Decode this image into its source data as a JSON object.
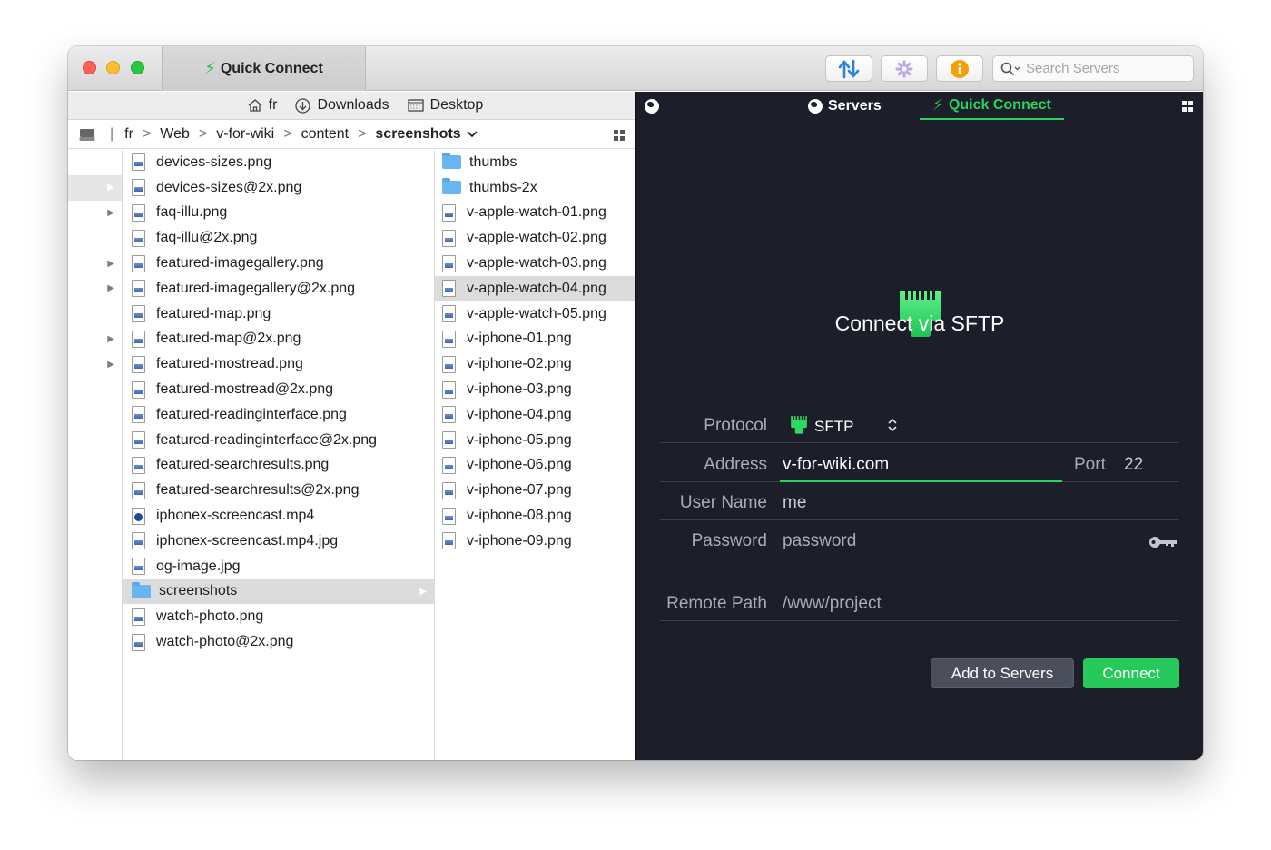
{
  "titlebar": {
    "tab_label": "Quick Connect",
    "search_placeholder": "Search Servers"
  },
  "favorites": [
    {
      "label": "fr",
      "icon": "home-icon"
    },
    {
      "label": "Downloads",
      "icon": "download-icon"
    },
    {
      "label": "Desktop",
      "icon": "desktop-icon"
    }
  ],
  "path": {
    "drive_icon": "drive-icon",
    "crumbs": [
      "fr",
      "Web",
      "v-for-wiki",
      "content",
      "screenshots"
    ]
  },
  "column1": [
    "devices-sizes.png",
    "devices-sizes@2x.png",
    "faq-illu.png",
    "faq-illu@2x.png",
    "featured-imagegallery.png",
    "featured-imagegallery@2x.png",
    "featured-map.png",
    "featured-map@2x.png",
    "featured-mostread.png",
    "featured-mostread@2x.png",
    "featured-readinginterface.png",
    "featured-readinginterface@2x.png",
    "featured-searchresults.png",
    "featured-searchresults@2x.png",
    "iphonex-screencast.mp4",
    "iphonex-screencast.mp4.jpg",
    "og-image.jpg",
    "screenshots",
    "watch-photo.png",
    "watch-photo@2x.png"
  ],
  "column2": [
    "thumbs",
    "thumbs-2x",
    "v-apple-watch-01.png",
    "v-apple-watch-02.png",
    "v-apple-watch-03.png",
    "v-apple-watch-04.png",
    "v-apple-watch-05.png",
    "v-iphone-01.png",
    "v-iphone-02.png",
    "v-iphone-03.png",
    "v-iphone-04.png",
    "v-iphone-05.png",
    "v-iphone-06.png",
    "v-iphone-07.png",
    "v-iphone-08.png",
    "v-iphone-09.png"
  ],
  "right": {
    "tabs": {
      "servers": "Servers",
      "quick_connect": "Quick Connect"
    },
    "heading": "Connect via SFTP",
    "protocol_label": "Protocol",
    "protocol_value": "SFTP",
    "address_label": "Address",
    "address_value": "v-for-wiki.com",
    "port_label": "Port",
    "port_value": "22",
    "username_label": "User Name",
    "username_value": "me",
    "password_label": "Password",
    "password_placeholder": "password",
    "remote_path_label": "Remote Path",
    "remote_path_placeholder": "/www/project",
    "add_button": "Add to Servers",
    "connect_button": "Connect"
  },
  "colors": {
    "accent_green": "#29d35a",
    "dark_bg": "#1c1f2a",
    "selection_gray": "#dcdcdc"
  }
}
